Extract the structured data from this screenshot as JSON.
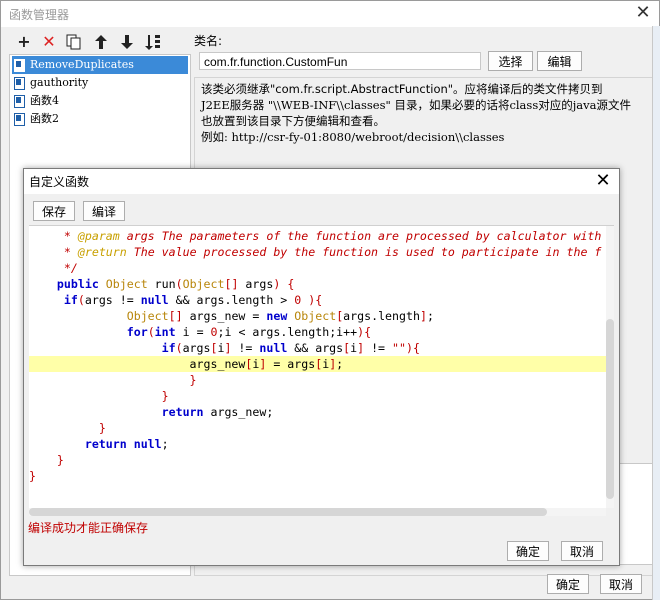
{
  "outer_window": {
    "title": "函数管理器",
    "ok_label": "确定",
    "cancel_label": "取消"
  },
  "toolbar": {
    "icons": [
      "add-icon",
      "delete-icon",
      "copy-icon",
      "move-up-icon",
      "move-down-icon",
      "sort-icon"
    ]
  },
  "function_list": [
    {
      "name": "RemoveDuplicates",
      "selected": true
    },
    {
      "name": "gauthority",
      "selected": false
    },
    {
      "name": "函数4",
      "selected": false
    },
    {
      "name": "函数2",
      "selected": false
    }
  ],
  "class_name": {
    "label": "类名:",
    "value": "com.fr.function.CustomFun",
    "select_label": "选择",
    "edit_label": "编辑"
  },
  "description": [
    "该类必须继承\"com.fr.script.AbstractFunction\"。应将编译后的类文件拷贝到",
    "J2EE服务器 \"\\\\WEB-INF\\\\classes\" 目录，如果必要的话将class对应的java源文件",
    "也放置到该目录下方便编辑和查看。",
    "例如: http://csr-fy-01:8080/webroot/decision\\\\classes"
  ],
  "dialog": {
    "title": "自定义函数",
    "save_label": "保存",
    "compile_label": "编译",
    "status": "编译成功才能正确保存",
    "ok_label": "确定",
    "cancel_label": "取消"
  },
  "code_lines": [
    "     * @param args The parameters of the function are processed by calculator with",
    "     * @return The value processed by the function is used to participate in the f",
    "     */",
    "    public Object run(Object[] args) {",
    "     if(args != null && args.length > 0 ){",
    "              Object[] args_new = new Object[args.length];",
    "              for(int i = 0;i < args.length;i++){",
    "                   if(args[i] != null && args[i] != \"\"){",
    "                       args_new[i] = args[i];",
    "                       }",
    "                   }",
    "                   return args_new;",
    "          }",
    "        return null;",
    "    }",
    "}"
  ],
  "highlighted_line": 8,
  "colors": {
    "selection": "#3b8ad8",
    "keyword": "#0000cc",
    "comment": "#c00000",
    "type": "#b8860b",
    "highlight": "#ffffa8",
    "status": "#c00000"
  }
}
